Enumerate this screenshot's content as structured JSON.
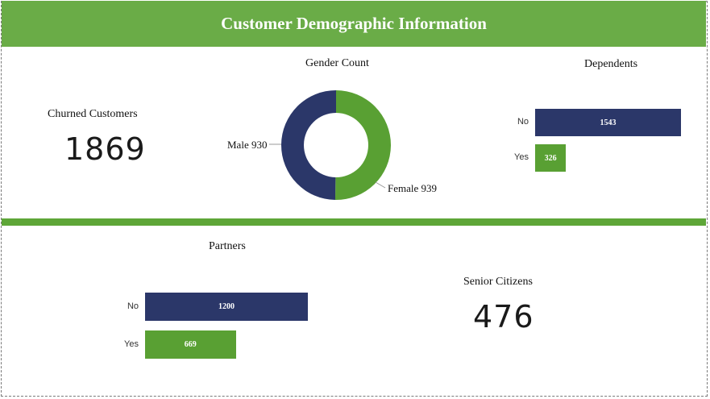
{
  "title": "Customer Demographic Information",
  "colors": {
    "header": "#6aac47",
    "navy": "#2b3769",
    "green": "#59a033"
  },
  "churned": {
    "label": "Churned Customers",
    "value": "1869"
  },
  "senior": {
    "label": "Senior Citizens",
    "value": "476"
  },
  "chart_data": [
    {
      "type": "pie",
      "title": "Gender Count",
      "categories": [
        "Male",
        "Female"
      ],
      "values": [
        930,
        939
      ],
      "labels": [
        "Male 930",
        "Female 939"
      ],
      "colors": [
        "#2b3769",
        "#59a033"
      ]
    },
    {
      "type": "bar",
      "orientation": "horizontal",
      "title": "Dependents",
      "categories": [
        "No",
        "Yes"
      ],
      "values": [
        1543,
        326
      ],
      "colors": [
        "#2b3769",
        "#59a033"
      ]
    },
    {
      "type": "bar",
      "orientation": "horizontal",
      "title": "Partners",
      "categories": [
        "No",
        "Yes"
      ],
      "values": [
        1200,
        669
      ],
      "colors": [
        "#2b3769",
        "#59a033"
      ]
    }
  ]
}
